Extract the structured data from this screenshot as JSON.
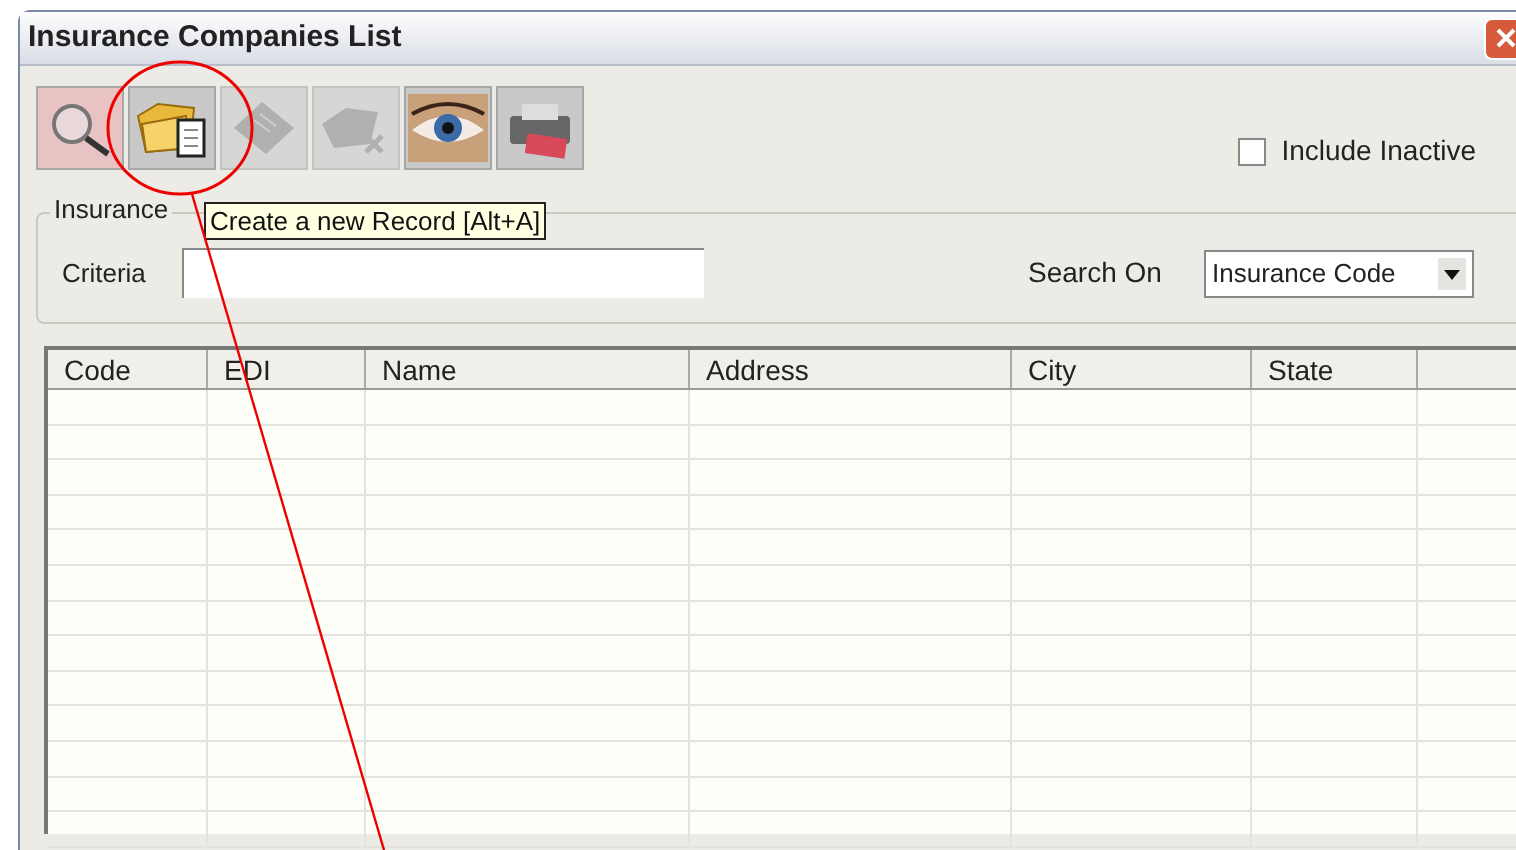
{
  "window": {
    "title": "Insurance Companies List"
  },
  "toolbar": [
    {
      "kind": "search",
      "disabled": false,
      "selected": true
    },
    {
      "kind": "new",
      "disabled": false,
      "selected": false
    },
    {
      "kind": "edit",
      "disabled": true,
      "selected": false
    },
    {
      "kind": "delete",
      "disabled": true,
      "selected": false
    },
    {
      "kind": "view",
      "disabled": false,
      "selected": false
    },
    {
      "kind": "print",
      "disabled": false,
      "selected": false
    }
  ],
  "include_inactive": {
    "label": "Include Inactive",
    "checked": false
  },
  "search_group": {
    "legend": "Insurance",
    "criteria_label": "Criteria",
    "search_on_label": "Search On",
    "search_on_value": "Insurance Code"
  },
  "tooltip": "Create a new Record [Alt+A]",
  "table": {
    "columns": [
      "Code",
      "EDI",
      "Name",
      "Address",
      "City",
      "State"
    ]
  }
}
